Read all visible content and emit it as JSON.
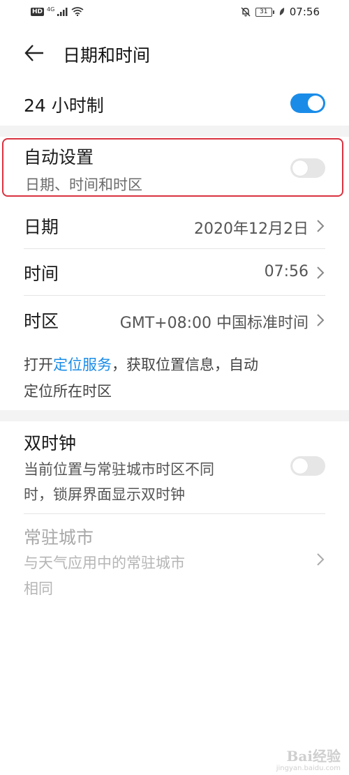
{
  "status_bar": {
    "hd": "HD",
    "network": "4G",
    "battery": "31",
    "time": "07:56"
  },
  "header": {
    "title": "日期和时间",
    "back_icon": "arrow-left-icon"
  },
  "rows": {
    "hour24": {
      "label": "24 小时制",
      "toggle": "on"
    },
    "auto_set": {
      "label": "自动设置",
      "sublabel": "日期、时间和时区",
      "toggle": "off"
    },
    "date": {
      "label": "日期",
      "value": "2020年12月2日"
    },
    "time": {
      "label": "时间",
      "value": "07:56"
    },
    "timezone": {
      "label": "时区",
      "value": "GMT+08:00 中国标准时间"
    }
  },
  "hint": {
    "prefix": "打开",
    "link": "定位服务",
    "line1_suffix": "，获取位置信息，自动",
    "line2": "定位所在时区"
  },
  "dual_clock": {
    "label": "双时钟",
    "sublabel_line1": "当前位置与常驻城市时区不同",
    "sublabel_line2": "时，锁屏界面显示双时钟",
    "toggle": "off"
  },
  "home_city": {
    "label": "常驻城市",
    "sublabel_line1": "与天气应用中的常驻城市",
    "sublabel_line2": "相同"
  },
  "watermark": {
    "logo": "Bai经验",
    "url": "jingyan.baidu.com"
  },
  "colors": {
    "accent": "#1a8ce8",
    "highlight_border": "#d93240",
    "toggle_off": "#e6e6e6"
  }
}
